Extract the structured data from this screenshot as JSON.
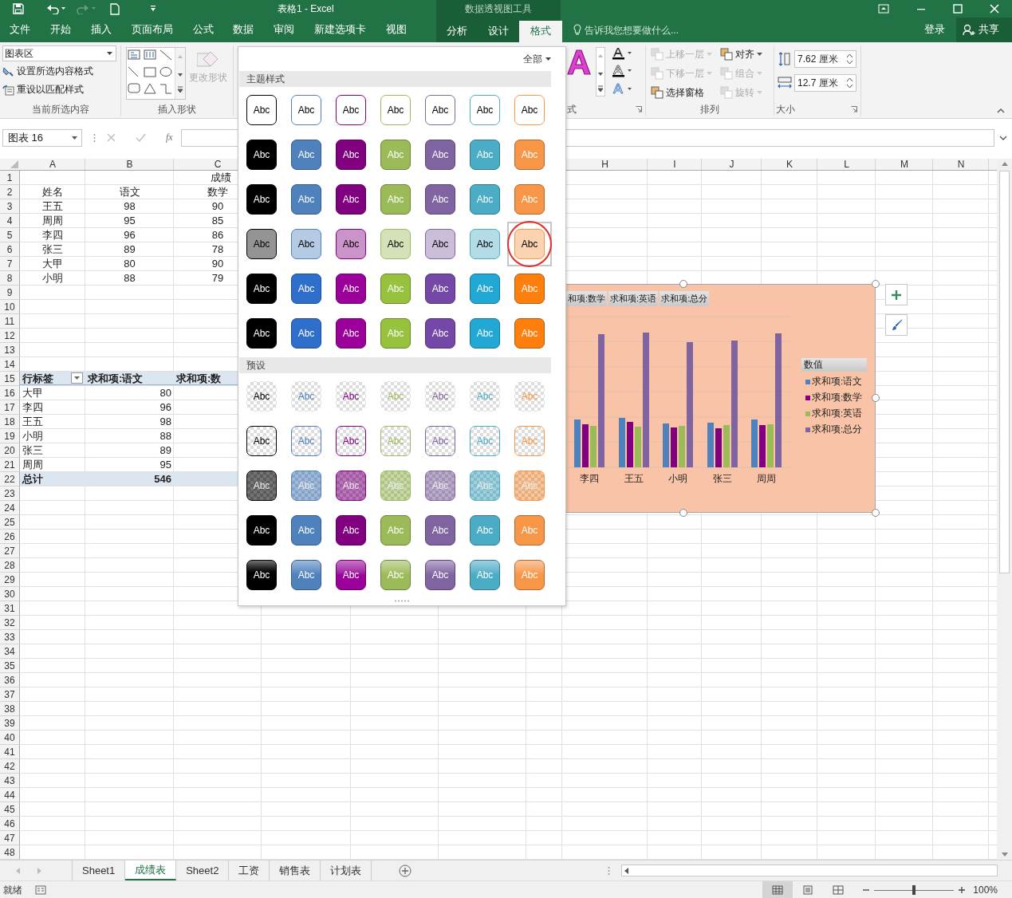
{
  "title_bar": {
    "title": "表格1 - Excel",
    "context_label": "数据透视图工具"
  },
  "tabs": [
    {
      "label": "文件",
      "selected": false,
      "kind": "normal"
    },
    {
      "label": "开始",
      "selected": false,
      "kind": "normal"
    },
    {
      "label": "插入",
      "selected": false,
      "kind": "normal"
    },
    {
      "label": "页面布局",
      "selected": false,
      "kind": "normal"
    },
    {
      "label": "公式",
      "selected": false,
      "kind": "normal"
    },
    {
      "label": "数据",
      "selected": false,
      "kind": "normal"
    },
    {
      "label": "审阅",
      "selected": false,
      "kind": "normal"
    },
    {
      "label": "新建选项卡",
      "selected": false,
      "kind": "normal"
    },
    {
      "label": "视图",
      "selected": false,
      "kind": "normal"
    },
    {
      "label": "分析",
      "selected": false,
      "kind": "context"
    },
    {
      "label": "设计",
      "selected": false,
      "kind": "context"
    },
    {
      "label": "格式",
      "selected": true,
      "kind": "context"
    }
  ],
  "tell_me": {
    "placeholder": "告诉我您想要做什么..."
  },
  "account": {
    "sign_in": "登录",
    "share": "共享"
  },
  "ribbon": {
    "current_selection": {
      "element_box": "图表区",
      "format_selection": "设置所选内容格式",
      "reset_style": "重设以匹配样式",
      "label": "当前所选内容"
    },
    "insert_shapes": {
      "change_shape": "更改形状",
      "label": "插入形状"
    },
    "wordart_styles": {
      "label": "式"
    },
    "arrange": {
      "items": [
        {
          "label": "上移一层",
          "disabled": true
        },
        {
          "label": "下移一层",
          "disabled": true
        },
        {
          "label": "选择窗格",
          "disabled": false
        },
        {
          "label": "对齐",
          "disabled": false
        },
        {
          "label": "组合",
          "disabled": true
        },
        {
          "label": "旋转",
          "disabled": true
        }
      ],
      "label": "排列"
    },
    "size": {
      "height": "7.62 厘米",
      "width": "12.7 厘米",
      "label": "大小"
    }
  },
  "formula_bar": {
    "name_box": "图表 16",
    "function_label": "fx"
  },
  "sheet": {
    "columns": [
      "A",
      "B",
      "C",
      "H",
      "I",
      "J",
      "K",
      "L",
      "M",
      "N"
    ],
    "rows": [
      {
        "label": "1",
        "kind": "title",
        "cells": [
          "成绩"
        ]
      },
      {
        "label": "2",
        "kind": "header",
        "cells": [
          "姓名",
          "语文",
          "数学"
        ]
      },
      {
        "label": "3",
        "kind": "data",
        "cells": [
          "王五",
          "98",
          "90"
        ]
      },
      {
        "label": "4",
        "kind": "data",
        "cells": [
          "周周",
          "95",
          "85"
        ]
      },
      {
        "label": "5",
        "kind": "data",
        "cells": [
          "李四",
          "96",
          "86"
        ]
      },
      {
        "label": "6",
        "kind": "data",
        "cells": [
          "张三",
          "89",
          "78"
        ]
      },
      {
        "label": "7",
        "kind": "data",
        "cells": [
          "大甲",
          "80",
          "90"
        ]
      },
      {
        "label": "8",
        "kind": "data",
        "cells": [
          "小明",
          "88",
          "79"
        ]
      },
      {
        "label": "9",
        "kind": "empty"
      },
      {
        "label": "10",
        "kind": "empty"
      },
      {
        "label": "11",
        "kind": "empty"
      },
      {
        "label": "12",
        "kind": "empty"
      },
      {
        "label": "13",
        "kind": "empty"
      },
      {
        "label": "14",
        "kind": "empty"
      },
      {
        "label": "15",
        "kind": "pivot-header",
        "cells": [
          "行标签",
          "求和项:语文",
          "求和项:数"
        ]
      },
      {
        "label": "16",
        "kind": "pivot",
        "cells": [
          "大甲",
          "80"
        ]
      },
      {
        "label": "17",
        "kind": "pivot",
        "cells": [
          "李四",
          "96"
        ]
      },
      {
        "label": "18",
        "kind": "pivot",
        "cells": [
          "王五",
          "98"
        ]
      },
      {
        "label": "19",
        "kind": "pivot",
        "cells": [
          "小明",
          "88"
        ]
      },
      {
        "label": "20",
        "kind": "pivot",
        "cells": [
          "张三",
          "89"
        ]
      },
      {
        "label": "21",
        "kind": "pivot",
        "cells": [
          "周周",
          "95"
        ]
      },
      {
        "label": "22",
        "kind": "total",
        "cells": [
          "总计",
          "546"
        ]
      },
      {
        "label": "23",
        "kind": "empty"
      },
      {
        "label": "24",
        "kind": "empty"
      },
      {
        "label": "25",
        "kind": "empty"
      },
      {
        "label": "26",
        "kind": "empty"
      },
      {
        "label": "27",
        "kind": "empty"
      },
      {
        "label": "28",
        "kind": "empty"
      },
      {
        "label": "29",
        "kind": "empty"
      },
      {
        "label": "30",
        "kind": "empty"
      },
      {
        "label": "31",
        "kind": "empty"
      },
      {
        "label": "32",
        "kind": "empty"
      },
      {
        "label": "33",
        "kind": "empty"
      },
      {
        "label": "34",
        "kind": "empty"
      },
      {
        "label": "35",
        "kind": "empty"
      },
      {
        "label": "36",
        "kind": "empty"
      },
      {
        "label": "37",
        "kind": "empty"
      },
      {
        "label": "38",
        "kind": "empty"
      },
      {
        "label": "39",
        "kind": "empty"
      },
      {
        "label": "40",
        "kind": "empty"
      },
      {
        "label": "41",
        "kind": "empty"
      },
      {
        "label": "42",
        "kind": "empty"
      },
      {
        "label": "43",
        "kind": "empty"
      },
      {
        "label": "44",
        "kind": "empty"
      },
      {
        "label": "45",
        "kind": "empty"
      },
      {
        "label": "46",
        "kind": "empty"
      },
      {
        "label": "47",
        "kind": "empty"
      },
      {
        "label": "48",
        "kind": "empty"
      }
    ]
  },
  "chart": {
    "series_buttons": [
      "和项:数学",
      "求和项:英语",
      "求和项:总分"
    ],
    "categories": [
      "李四",
      "王五",
      "小明",
      "张三",
      "周周"
    ],
    "legend": {
      "title": "数值",
      "items": [
        {
          "label": "求和项:语文",
          "color": "#4f81bd"
        },
        {
          "label": "求和项:数学",
          "color": "#800080"
        },
        {
          "label": "求和项:英语",
          "color": "#9bbb59"
        },
        {
          "label": "求和项:总分",
          "color": "#8064a2"
        }
      ]
    }
  },
  "style_gallery": {
    "filter": "全部",
    "sections": [
      {
        "title": "主题样式",
        "rows": [
          {
            "kind": "outline",
            "swatches": [
              {
                "label": "Abc",
                "color": "#000000",
                "selected": false
              },
              {
                "label": "Abc",
                "color": "#4f81bd",
                "selected": false
              },
              {
                "label": "Abc",
                "color": "#800080",
                "selected": false
              },
              {
                "label": "Abc",
                "color": "#9bbb59",
                "selected": false
              },
              {
                "label": "Abc",
                "color": "#8064a2",
                "selected": false
              },
              {
                "label": "Abc",
                "color": "#4bacc6",
                "selected": false
              },
              {
                "label": "Abc",
                "color": "#f79646",
                "selected": false
              }
            ]
          },
          {
            "kind": "solid",
            "swatches": [
              {
                "label": "Abc",
                "color": "#000000",
                "selected": false
              },
              {
                "label": "Abc",
                "color": "#4f81bd",
                "selected": false
              },
              {
                "label": "Abc",
                "color": "#800080",
                "selected": false
              },
              {
                "label": "Abc",
                "color": "#9bbb59",
                "selected": false
              },
              {
                "label": "Abc",
                "color": "#8064a2",
                "selected": false
              },
              {
                "label": "Abc",
                "color": "#4bacc6",
                "selected": false
              },
              {
                "label": "Abc",
                "color": "#f79646",
                "selected": false
              }
            ]
          },
          {
            "kind": "solid",
            "swatches": [
              {
                "label": "Abc",
                "color": "#000000",
                "selected": false
              },
              {
                "label": "Abc",
                "color": "#4f81bd",
                "selected": false
              },
              {
                "label": "Abc",
                "color": "#800080",
                "selected": false
              },
              {
                "label": "Abc",
                "color": "#9bbb59",
                "selected": false
              },
              {
                "label": "Abc",
                "color": "#8064a2",
                "selected": false
              },
              {
                "label": "Abc",
                "color": "#4bacc6",
                "selected": false
              },
              {
                "label": "Abc",
                "color": "#f79646",
                "selected": false
              }
            ]
          },
          {
            "kind": "light",
            "swatches": [
              {
                "label": "Abc",
                "color": "#000000",
                "selected": false
              },
              {
                "label": "Abc",
                "color": "#4f81bd",
                "selected": false
              },
              {
                "label": "Abc",
                "color": "#800080",
                "selected": false
              },
              {
                "label": "Abc",
                "color": "#9bbb59",
                "selected": false
              },
              {
                "label": "Abc",
                "color": "#8064a2",
                "selected": false
              },
              {
                "label": "Abc",
                "color": "#4bacc6",
                "selected": false
              },
              {
                "label": "Abc",
                "color": "#f79646",
                "selected": true
              }
            ]
          },
          {
            "kind": "intense",
            "swatches": [
              {
                "label": "Abc",
                "color": "#000000",
                "selected": false
              },
              {
                "label": "Abc",
                "color": "#2e6fcc",
                "selected": false
              },
              {
                "label": "Abc",
                "color": "#9b009b",
                "selected": false
              },
              {
                "label": "Abc",
                "color": "#97c23d",
                "selected": false
              },
              {
                "label": "Abc",
                "color": "#7448a6",
                "selected": false
              },
              {
                "label": "Abc",
                "color": "#22a8d4",
                "selected": false
              },
              {
                "label": "Abc",
                "color": "#ff7f0e",
                "selected": false
              }
            ]
          },
          {
            "kind": "intense",
            "swatches": [
              {
                "label": "Abc",
                "color": "#000000",
                "selected": false
              },
              {
                "label": "Abc",
                "color": "#2e6fcc",
                "selected": false
              },
              {
                "label": "Abc",
                "color": "#9b009b",
                "selected": false
              },
              {
                "label": "Abc",
                "color": "#97c23d",
                "selected": false
              },
              {
                "label": "Abc",
                "color": "#7448a6",
                "selected": false
              },
              {
                "label": "Abc",
                "color": "#22a8d4",
                "selected": false
              },
              {
                "label": "Abc",
                "color": "#ff7f0e",
                "selected": false
              }
            ]
          }
        ]
      },
      {
        "title": "预设",
        "rows": [
          {
            "kind": "clear",
            "swatches": [
              {
                "label": "Abc",
                "color": "#000000",
                "selected": false
              },
              {
                "label": "Abc",
                "color": "#4f81bd",
                "selected": false
              },
              {
                "label": "Abc",
                "color": "#800080",
                "selected": false
              },
              {
                "label": "Abc",
                "color": "#9bbb59",
                "selected": false
              },
              {
                "label": "Abc",
                "color": "#8064a2",
                "selected": false
              },
              {
                "label": "Abc",
                "color": "#4bacc6",
                "selected": false
              },
              {
                "label": "Abc",
                "color": "#f79646",
                "selected": false
              }
            ]
          },
          {
            "kind": "clear-outline",
            "swatches": [
              {
                "label": "Abc",
                "color": "#000000",
                "selected": false
              },
              {
                "label": "Abc",
                "color": "#4f81bd",
                "selected": false
              },
              {
                "label": "Abc",
                "color": "#800080",
                "selected": false
              },
              {
                "label": "Abc",
                "color": "#9bbb59",
                "selected": false
              },
              {
                "label": "Abc",
                "color": "#8064a2",
                "selected": false
              },
              {
                "label": "Abc",
                "color": "#4bacc6",
                "selected": false
              },
              {
                "label": "Abc",
                "color": "#f79646",
                "selected": false
              }
            ]
          },
          {
            "kind": "translucent",
            "swatches": [
              {
                "label": "Abc",
                "color": "#000000",
                "selected": false
              },
              {
                "label": "Abc",
                "color": "#4f81bd",
                "selected": false
              },
              {
                "label": "Abc",
                "color": "#800080",
                "selected": false
              },
              {
                "label": "Abc",
                "color": "#9bbb59",
                "selected": false
              },
              {
                "label": "Abc",
                "color": "#8064a2",
                "selected": false
              },
              {
                "label": "Abc",
                "color": "#4bacc6",
                "selected": false
              },
              {
                "label": "Abc",
                "color": "#f79646",
                "selected": false
              }
            ]
          },
          {
            "kind": "solid",
            "swatches": [
              {
                "label": "Abc",
                "color": "#000000",
                "selected": false
              },
              {
                "label": "Abc",
                "color": "#4f81bd",
                "selected": false
              },
              {
                "label": "Abc",
                "color": "#800080",
                "selected": false
              },
              {
                "label": "Abc",
                "color": "#9bbb59",
                "selected": false
              },
              {
                "label": "Abc",
                "color": "#8064a2",
                "selected": false
              },
              {
                "label": "Abc",
                "color": "#4bacc6",
                "selected": false
              },
              {
                "label": "Abc",
                "color": "#f79646",
                "selected": false
              }
            ]
          },
          {
            "kind": "glossy",
            "swatches": [
              {
                "label": "Abc",
                "color": "#000000",
                "selected": false
              },
              {
                "label": "Abc",
                "color": "#4f81bd",
                "selected": false
              },
              {
                "label": "Abc",
                "color": "#9b009b",
                "selected": false
              },
              {
                "label": "Abc",
                "color": "#9bbb59",
                "selected": false
              },
              {
                "label": "Abc",
                "color": "#8064a2",
                "selected": false
              },
              {
                "label": "Abc",
                "color": "#4bacc6",
                "selected": false
              },
              {
                "label": "Abc",
                "color": "#f79646",
                "selected": false
              }
            ]
          }
        ]
      }
    ]
  },
  "sheet_tabs": [
    {
      "label": "Sheet1",
      "selected": false
    },
    {
      "label": "成绩表",
      "selected": true
    },
    {
      "label": "Sheet2",
      "selected": false
    },
    {
      "label": "工资",
      "selected": false
    },
    {
      "label": "销售表",
      "selected": false
    },
    {
      "label": "计划表",
      "selected": false
    }
  ],
  "status_bar": {
    "status": "就绪",
    "zoom": "100%",
    "zoom_slider": {
      "level": 0.5
    }
  }
}
